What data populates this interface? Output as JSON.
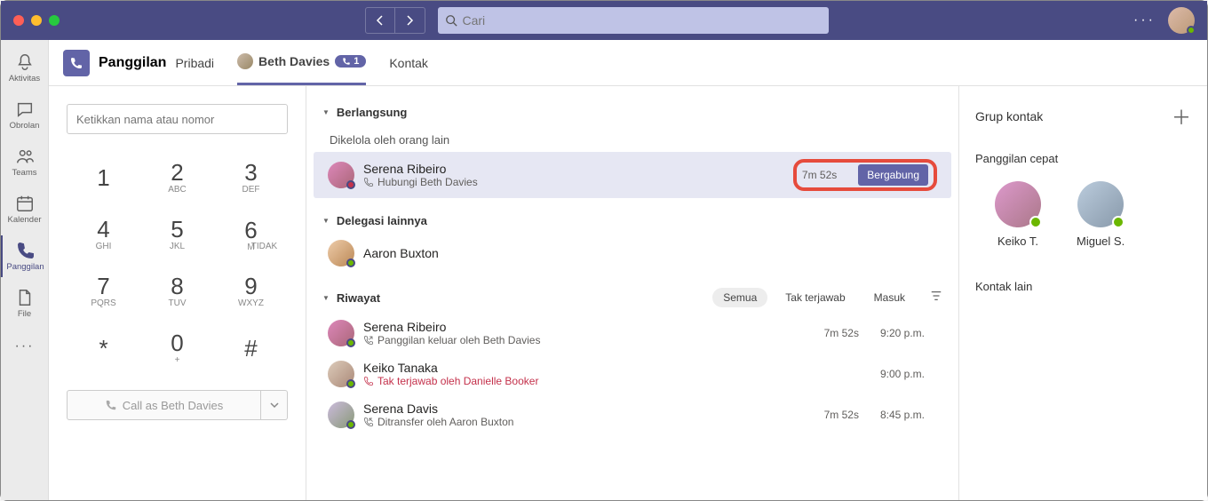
{
  "search_placeholder": "Cari",
  "rail": [
    {
      "label": "Aktivitas"
    },
    {
      "label": "Obrolan"
    },
    {
      "label": "Teams"
    },
    {
      "label": "Kalender"
    },
    {
      "label": "Panggilan"
    },
    {
      "label": "File"
    }
  ],
  "header": {
    "title": "Panggilan",
    "tab_personal": "Pribadi",
    "tab_beth": "Beth Davies",
    "beth_badge": "1",
    "tab_contacts": "Kontak"
  },
  "dial": {
    "placeholder": "Ketikkan nama atau nomor",
    "keys": [
      {
        "n": "1",
        "s": ""
      },
      {
        "n": "2",
        "s": "ABC"
      },
      {
        "n": "3",
        "s": "DEF"
      },
      {
        "n": "4",
        "s": "GHI"
      },
      {
        "n": "5",
        "s": "JKL"
      },
      {
        "n": "6",
        "s": "MNO"
      },
      {
        "n": "7",
        "s": "PQRS"
      },
      {
        "n": "8",
        "s": "TUV"
      },
      {
        "n": "9",
        "s": "WXYZ"
      },
      {
        "n": "*",
        "s": ""
      },
      {
        "n": "0",
        "s": "+"
      },
      {
        "n": "#",
        "s": ""
      }
    ],
    "no_sub": "TIDAK",
    "call_as": "Call as Beth Davies"
  },
  "list": {
    "sect_ongoing": "Berlangsung",
    "managed_by": "Dikelola oleh orang lain",
    "ongoing": {
      "name": "Serena Ribeiro",
      "sub": "Hubungi Beth Davies",
      "duration": "7m 52s",
      "join": "Bergabung"
    },
    "sect_delegates": "Delegasi lainnya",
    "delegate": {
      "name": "Aaron Buxton"
    },
    "sect_history": "Riwayat",
    "filters": {
      "all": "Semua",
      "missed": "Tak terjawab",
      "incoming": "Masuk"
    },
    "history": [
      {
        "name": "Serena Ribeiro",
        "sub": "Panggilan keluar oleh Beth Davies",
        "dur": "7m 52s",
        "time": "9:20 p.m.",
        "type": "out"
      },
      {
        "name": "Keiko Tanaka",
        "sub": "Tak terjawab oleh Danielle Booker",
        "dur": "",
        "time": "9:00 p.m.",
        "type": "missed"
      },
      {
        "name": "Serena Davis",
        "sub": "Ditransfer oleh Aaron Buxton",
        "dur": "7m 52s",
        "time": "8:45 p.m.",
        "type": "in"
      }
    ]
  },
  "contacts": {
    "group_title": "Grup kontak",
    "speed_title": "Panggilan cepat",
    "speed": [
      {
        "name": "Keiko T."
      },
      {
        "name": "Miguel S."
      }
    ],
    "other_title": "Kontak lain"
  }
}
